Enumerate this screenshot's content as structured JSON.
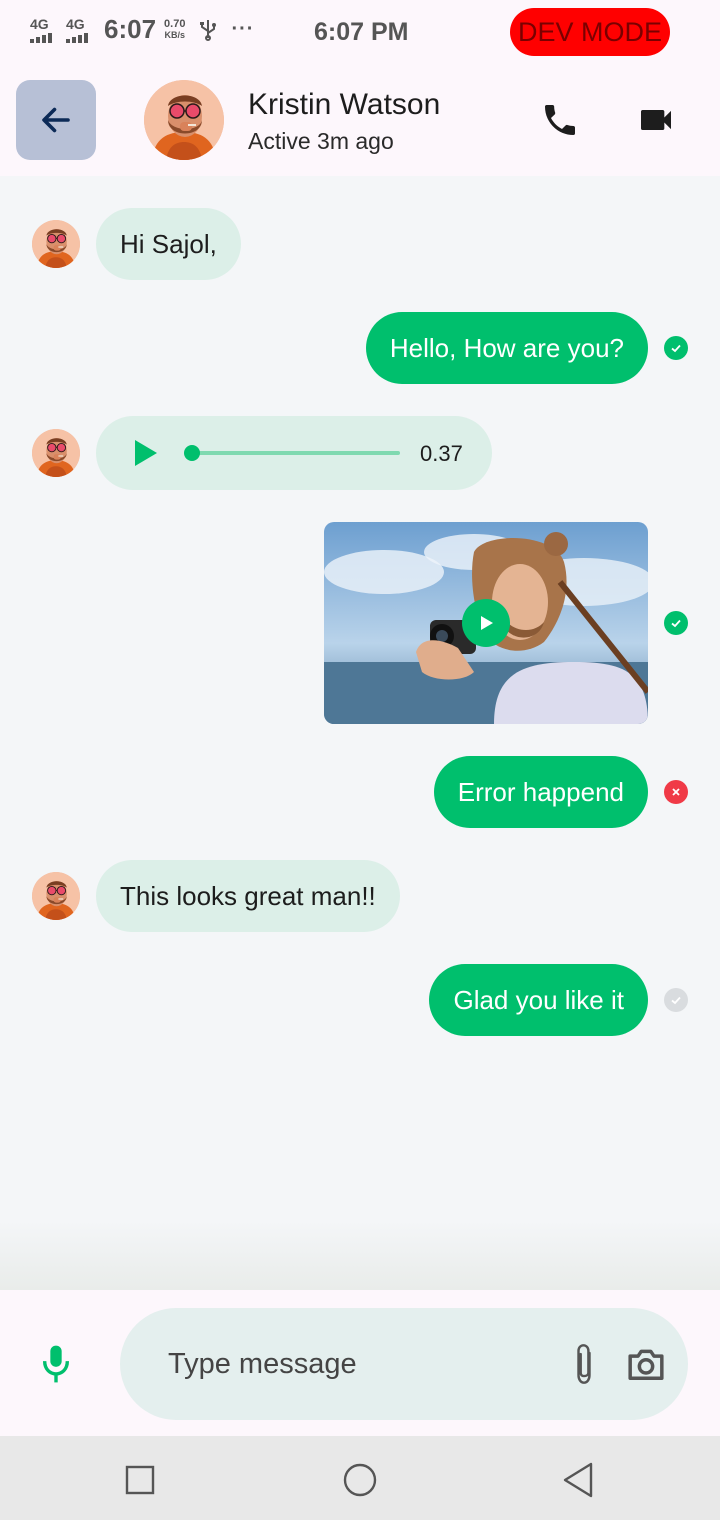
{
  "status_bar": {
    "network_1": "4G",
    "network_2": "4G",
    "time": "6:07",
    "speed_value": "0.70",
    "speed_unit": "KB/s",
    "overflow": "···",
    "center_time": "6:07 PM",
    "dev_badge": "DEV MODE"
  },
  "header": {
    "contact_name": "Kristin Watson",
    "contact_status": "Active 3m ago",
    "icons": [
      "arrow-left-icon",
      "phone-icon",
      "video-camera-icon"
    ]
  },
  "messages": [
    {
      "direction": "incoming",
      "type": "text",
      "text": "Hi Sajol,"
    },
    {
      "direction": "outgoing",
      "type": "text",
      "text": "Hello, How are you?",
      "status": "viewed"
    },
    {
      "direction": "incoming",
      "type": "audio",
      "duration": "0.37"
    },
    {
      "direction": "outgoing",
      "type": "video",
      "status": "viewed"
    },
    {
      "direction": "outgoing",
      "type": "text",
      "text": "Error happend",
      "status": "error"
    },
    {
      "direction": "incoming",
      "type": "text",
      "text": "This looks great man!!"
    },
    {
      "direction": "outgoing",
      "type": "text",
      "text": "Glad you like it",
      "status": "sent"
    }
  ],
  "composer": {
    "placeholder": "Type message",
    "icons": [
      "microphone-icon",
      "paperclip-icon",
      "camera-icon"
    ]
  },
  "navigation": {
    "icons": [
      "recents-square-icon",
      "home-circle-icon",
      "back-triangle-icon"
    ]
  },
  "colors": {
    "accent": "#00bf6d",
    "incoming_bubble": "#dcefe8",
    "error": "#f03a47",
    "dev_badge": "#ff0000",
    "back_button": "#b7c0d6"
  }
}
